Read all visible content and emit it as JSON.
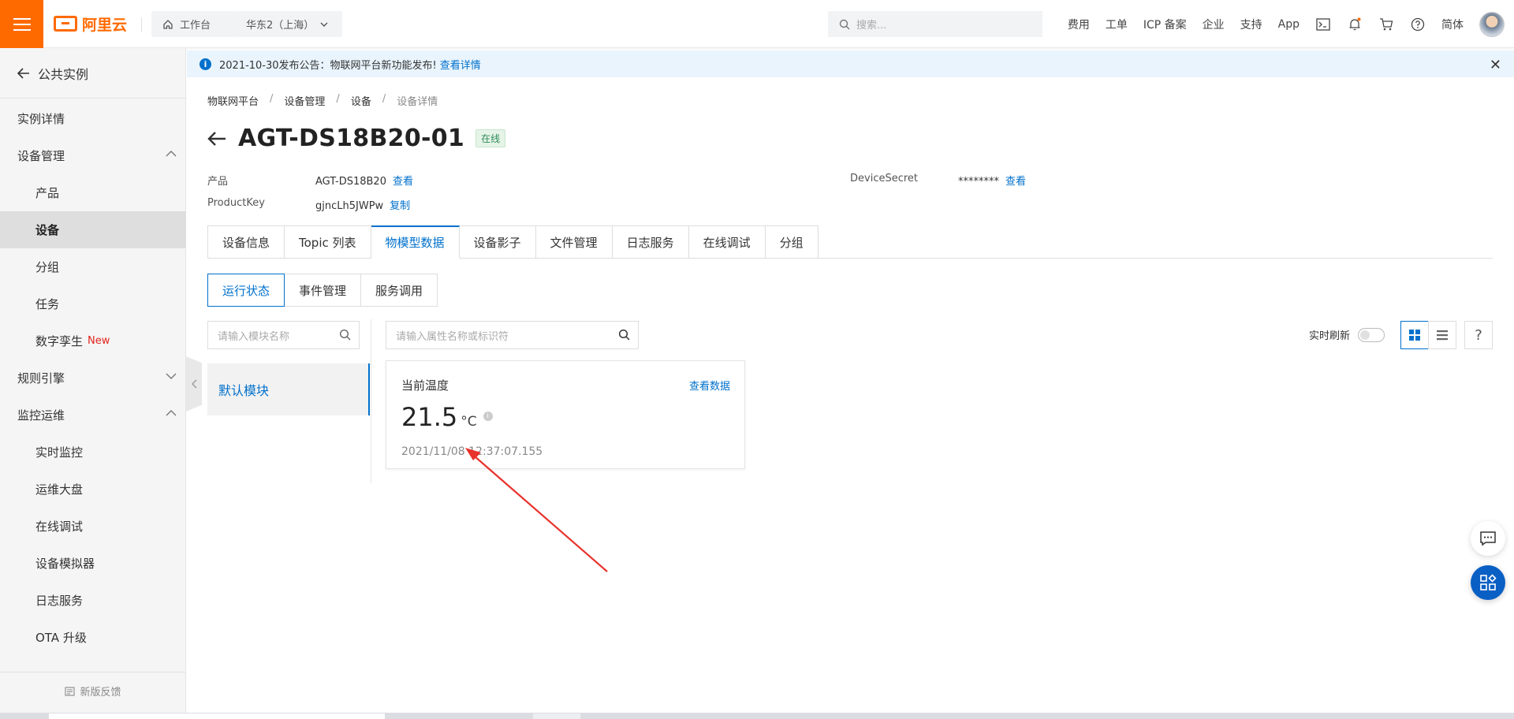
{
  "topbar": {
    "brand": "阿里云",
    "workbench": "工作台",
    "region": "华东2（上海）",
    "search_placeholder": "搜索...",
    "nav": [
      "费用",
      "工单",
      "ICP 备案",
      "企业",
      "支持",
      "App"
    ],
    "lang": "简体",
    "accent": "#ff6a00"
  },
  "sidebar": {
    "back_label": "公共实例",
    "items": [
      {
        "label": "实例详情"
      },
      {
        "label": "设备管理"
      },
      {
        "label": "产品"
      },
      {
        "label": "设备"
      },
      {
        "label": "分组"
      },
      {
        "label": "任务"
      },
      {
        "label": "数字孪生",
        "tag": "New"
      },
      {
        "label": "规则引擎"
      },
      {
        "label": "监控运维"
      },
      {
        "label": "实时监控"
      },
      {
        "label": "运维大盘"
      },
      {
        "label": "在线调试"
      },
      {
        "label": "设备模拟器"
      },
      {
        "label": "日志服务"
      },
      {
        "label": "OTA 升级"
      }
    ],
    "feedback": "新版反馈"
  },
  "notice": {
    "text": "2021-10-30发布公告：物联网平台新功能发布!",
    "link": "查看详情"
  },
  "breadcrumb": [
    "物联网平台",
    "设备管理",
    "设备",
    "设备详情"
  ],
  "device": {
    "name": "AGT-DS18B20-01",
    "status": "在线",
    "product_label": "产品",
    "product_value": "AGT-DS18B20",
    "product_link": "查看",
    "productkey_label": "ProductKey",
    "productkey_value": "gjncLh5JWPw",
    "productkey_link": "复制",
    "secret_label": "DeviceSecret",
    "secret_value": "********",
    "secret_link": "查看"
  },
  "tabs": [
    "设备信息",
    "Topic 列表",
    "物模型数据",
    "设备影子",
    "文件管理",
    "日志服务",
    "在线调试",
    "分组"
  ],
  "subtabs": [
    "运行状态",
    "事件管理",
    "服务调用"
  ],
  "filters": {
    "module_placeholder": "请输入模块名称",
    "property_placeholder": "请输入属性名称或标识符",
    "refresh_label": "实时刷新"
  },
  "modules": [
    "默认模块"
  ],
  "property_card": {
    "name": "当前温度",
    "view_link": "查看数据",
    "value": "21.5",
    "unit": "°C",
    "timestamp": "2021/11/08 12:37:07.155"
  }
}
